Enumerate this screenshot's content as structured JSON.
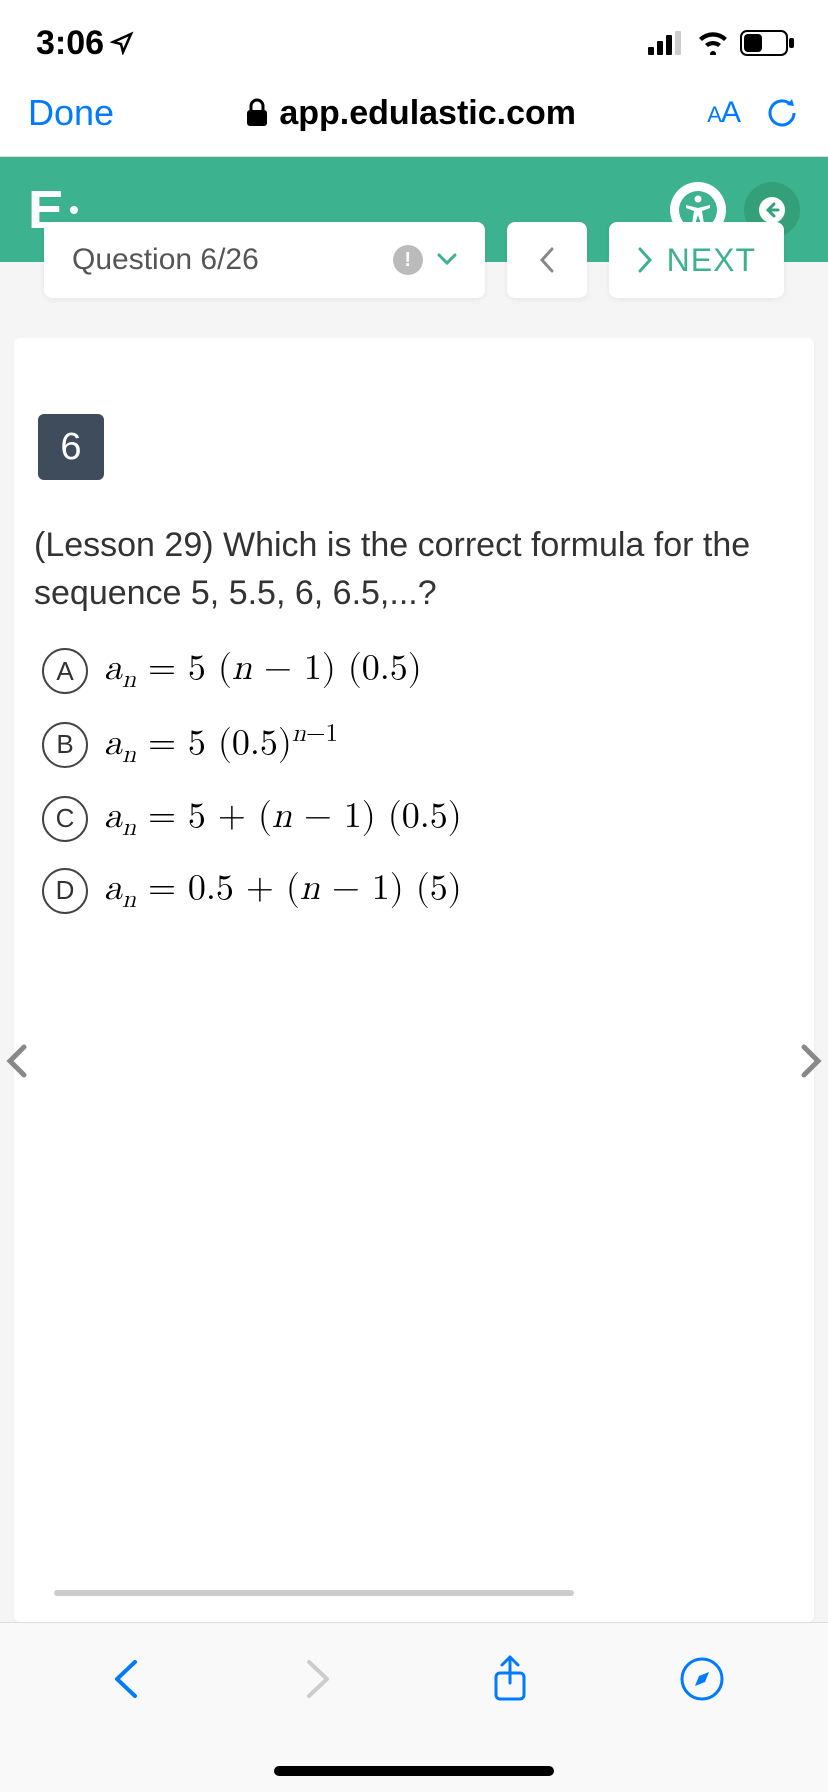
{
  "status_bar": {
    "time": "3:06"
  },
  "browser": {
    "done_label": "Done",
    "url": "app.edulastic.com",
    "text_size_label": "AA"
  },
  "app": {
    "logo": "E"
  },
  "navigation": {
    "question_label": "Question 6/26",
    "next_label": "NEXT",
    "prev_symbol": "<",
    "next_symbol": ">"
  },
  "question": {
    "number": "6",
    "text": "(Lesson 29) Which is the correct formula for the sequence 5, 5.5, 6, 6.5,...?",
    "options": [
      {
        "letter": "A",
        "formula_html": "<i>a<sub>n</sub></i> = 5 (<i>n</i> − 1) (0.5)"
      },
      {
        "letter": "B",
        "formula_html": "<i>a<sub>n</sub></i> = 5 (0.5)<sup><i>n</i>−1</sup>"
      },
      {
        "letter": "C",
        "formula_html": "<i>a<sub>n</sub></i> = 5 + (<i>n</i> − 1) (0.5)"
      },
      {
        "letter": "D",
        "formula_html": "<i>a<sub>n</sub></i> = 0.5 + (<i>n</i> − 1) (5)"
      }
    ]
  },
  "colors": {
    "accent": "#3db28f",
    "ios_blue": "#007aff"
  }
}
